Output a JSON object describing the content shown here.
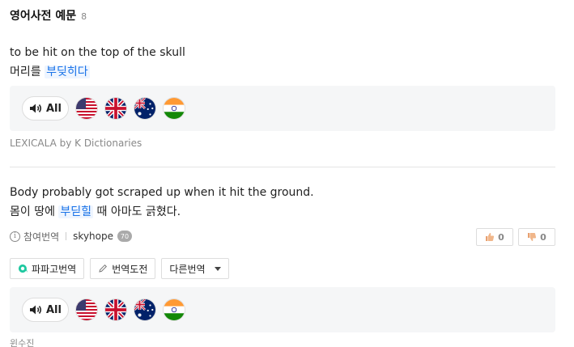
{
  "header": {
    "title": "영어사전 예문",
    "count": "8"
  },
  "examples": [
    {
      "en": "to be hit on the top of the skull",
      "ko_before": "머리를 ",
      "ko_highlight": "부딪히다",
      "ko_after": "",
      "source": "LEXICALA by K Dictionaries"
    },
    {
      "en": "Body probably got scraped up when it hit the ground.",
      "ko_before": "몸이 땅에 ",
      "ko_highlight": "부딛힐",
      "ko_after": " 때 아마도 긁혔다.",
      "meta": {
        "ref_label": "참여번역",
        "user": "skyhope",
        "level": "70"
      },
      "votes": {
        "up": "0",
        "down": "0"
      },
      "tools": {
        "papago": "파파고번역",
        "challenge": "번역도전",
        "other": "다른번역"
      },
      "source": "윈수진"
    }
  ],
  "audio": {
    "all_label": "All",
    "flags": [
      "us-flag-icon",
      "uk-flag-icon",
      "au-flag-icon",
      "in-flag-icon"
    ]
  },
  "colors": {
    "highlight": "#1a73e8",
    "highlight_bg": "#eef5ff",
    "box_bg": "#f5f6f7"
  }
}
